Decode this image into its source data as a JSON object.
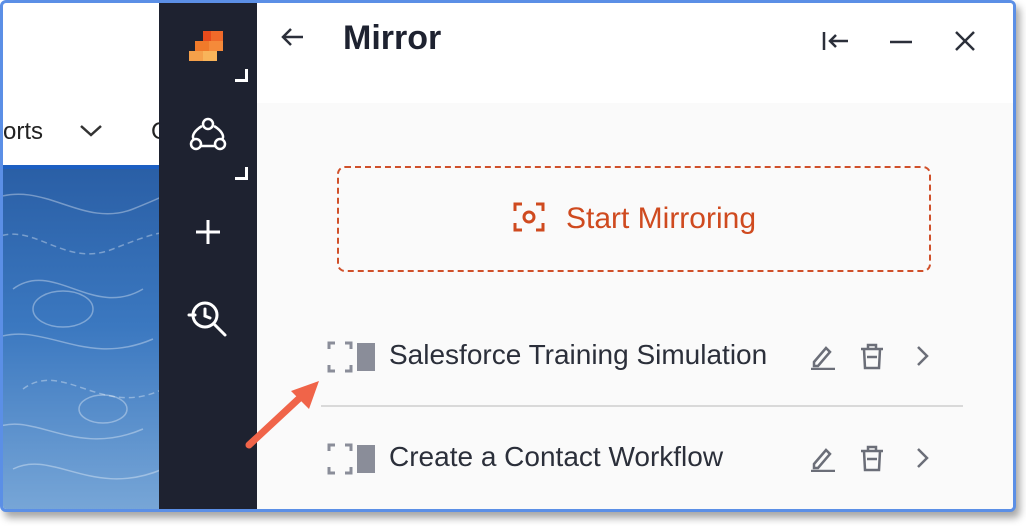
{
  "background_app": {
    "nav_partial_text": "orts",
    "nav_next_partial": "C"
  },
  "rail": {
    "icons": [
      "logo-icon",
      "network-icon",
      "plus-icon",
      "search-refresh-icon"
    ]
  },
  "panel": {
    "title": "Mirror",
    "header_buttons": [
      "collapse-left-icon",
      "minimize-icon",
      "close-icon"
    ],
    "start_button_label": "Start Mirroring",
    "items": [
      {
        "label": "Salesforce Training Simulation"
      },
      {
        "label": "Create a Contact Workflow"
      }
    ]
  },
  "colors": {
    "accent": "#cf4a1f",
    "rail_bg": "#1e2230",
    "frame_border": "#5b8fe6",
    "callout_arrow": "#f06449"
  }
}
